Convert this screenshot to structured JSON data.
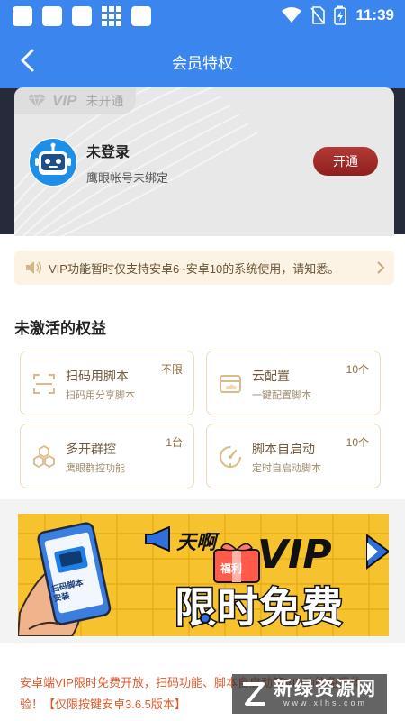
{
  "status_bar": {
    "time": "11:39"
  },
  "header": {
    "title": "会员特权"
  },
  "vip_card": {
    "badge": "VIP",
    "status": "未开通",
    "user_name": "未登录",
    "account_status": "鹰眼帐号未绑定",
    "open_button": "开通"
  },
  "notice": {
    "text": "VIP功能暂时仅支持安卓6~安卓10的系统使用，请知悉。"
  },
  "benefits": {
    "title": "未激活的权益",
    "items": [
      {
        "name": "扫码用脚本",
        "desc": "扫码用分享脚本",
        "qty": "不限",
        "icon": "scan-icon"
      },
      {
        "name": "云配置",
        "desc": "一键配置脚本",
        "qty": "10个",
        "icon": "cloud-config-icon"
      },
      {
        "name": "多开群控",
        "desc": "鹰眼群控功能",
        "qty": "1台",
        "icon": "hexagon-cluster-icon"
      },
      {
        "name": "脚本自启动",
        "desc": "定时自启动脚本",
        "qty": "10个",
        "icon": "timer-icon"
      }
    ]
  },
  "promo": {
    "phone_text": "扫码脚本安装",
    "shout": "天啊",
    "ribbon": "福利",
    "vip": "VIP",
    "headline": "限时免费"
  },
  "footer": {
    "text": "安卓端VIP限时免费开放，扫码功能、脚本自启动等VIP功能免费体验！【仅限按键安卓3.6.5版本】"
  },
  "watermark": {
    "name": "新绿资源网",
    "domain": "www.xlhs.com"
  },
  "colors": {
    "header_blue": "#3a86ee",
    "vip_button": "#9c2a27",
    "footer_text": "#e05a2c",
    "promo_yellow": "#f6c22d"
  }
}
